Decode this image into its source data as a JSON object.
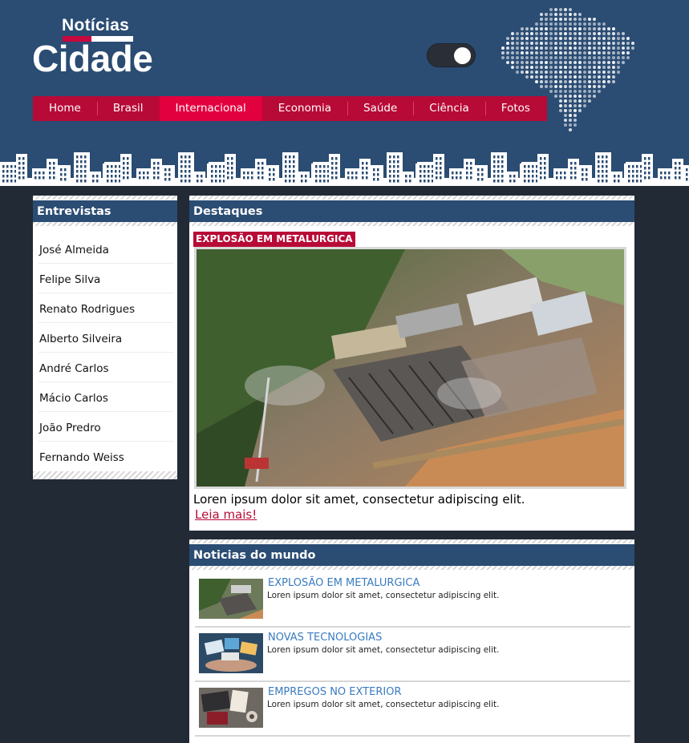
{
  "header": {
    "logo_small": "Notícias",
    "logo_big": "Cidade",
    "theme_toggle": {
      "state": "on"
    },
    "nav": [
      {
        "label": "Home",
        "active": false
      },
      {
        "label": "Brasil",
        "active": false
      },
      {
        "label": "Internacional",
        "active": true
      },
      {
        "label": "Economia",
        "active": false
      },
      {
        "label": "Saúde",
        "active": false
      },
      {
        "label": "Ciência",
        "active": false
      },
      {
        "label": "Fotos",
        "active": false
      }
    ]
  },
  "sidebar": {
    "title": "Entrevistas",
    "items": [
      "José Almeida",
      "Felipe Silva",
      "Renato Rodrigues",
      "Alberto Silveira",
      "André Carlos",
      "Mácio Carlos",
      "João Predro",
      "Fernando Weiss"
    ]
  },
  "destaques": {
    "title": "Destaques",
    "tag": "EXPLOSÃO EM METALURGICA",
    "image": "aerial-photo-destroyed-factory",
    "text": "Loren ipsum dolor sit amet, consectetur adipiscing elit.",
    "link": "Leia mais!"
  },
  "mundo": {
    "title": "Noticias do mundo",
    "items": [
      {
        "title": "EXPLOSÃO EM METALURGICA",
        "desc": "Loren ipsum dolor sit amet, consectetur adipiscing elit.",
        "thumb": "factory-aerial-thumbnail"
      },
      {
        "title": "NOVAS TECNOLOGIAS",
        "desc": "Loren ipsum dolor sit amet, consectetur adipiscing elit.",
        "thumb": "devices-hand-thumbnail"
      },
      {
        "title": "EMPREGOS NO EXTERIOR",
        "desc": "Loren ipsum dolor sit amet, consectetur adipiscing elit.",
        "thumb": "desk-laptop-thumbnail"
      }
    ]
  },
  "colors": {
    "header_bg": "#2b4c73",
    "nav_bg": "#b80a36",
    "nav_active": "#e3003f",
    "page_bg": "#222a35",
    "news_title": "#3a7bc0"
  }
}
